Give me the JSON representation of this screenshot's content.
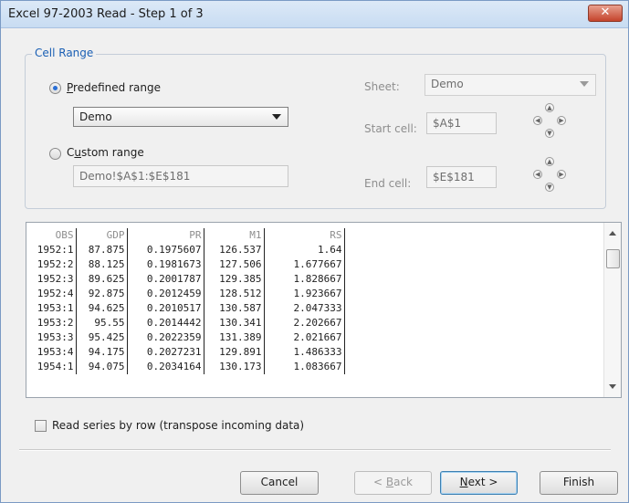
{
  "window": {
    "title": "Excel 97-2003 Read - Step 1 of 3",
    "close_symbol": "✕"
  },
  "cell_range": {
    "group_label": "Cell Range",
    "predefined_label_u": "P",
    "predefined_label_rest": "redefined range",
    "predefined_selected": true,
    "predefined_value": "Demo",
    "custom_label_pre": "C",
    "custom_label_u": "u",
    "custom_label_rest": "stom range",
    "custom_value": "Demo!$A$1:$E$181",
    "sheet_label": "Sheet:",
    "sheet_value": "Demo",
    "start_label": "Start cell:",
    "start_value": "$A$1",
    "end_label": "End cell:",
    "end_value": "$E$181"
  },
  "preview": {
    "headers": [
      "OBS",
      "GDP",
      "PR",
      "M1",
      "RS"
    ],
    "rows": [
      [
        "1952:1",
        "87.875",
        "0.1975607",
        "126.537",
        "1.64"
      ],
      [
        "1952:2",
        "88.125",
        "0.1981673",
        "127.506",
        "1.677667"
      ],
      [
        "1952:3",
        "89.625",
        "0.2001787",
        "129.385",
        "1.828667"
      ],
      [
        "1952:4",
        "92.875",
        "0.2012459",
        "128.512",
        "1.923667"
      ],
      [
        "1953:1",
        "94.625",
        "0.2010517",
        "130.587",
        "2.047333"
      ],
      [
        "1953:2",
        "95.55",
        "0.2014442",
        "130.341",
        "2.202667"
      ],
      [
        "1953:3",
        "95.425",
        "0.2022359",
        "131.389",
        "2.021667"
      ],
      [
        "1953:4",
        "94.175",
        "0.2027231",
        "129.891",
        "1.486333"
      ],
      [
        "1954:1",
        "94.075",
        "0.2034164",
        "130.173",
        "1.083667"
      ]
    ]
  },
  "options": {
    "transpose_label": "Read series by row (transpose incoming data)",
    "transpose_checked": false
  },
  "buttons": {
    "cancel": "Cancel",
    "back_pre": "< ",
    "back_u": "B",
    "back_rest": "ack",
    "next_u": "N",
    "next_rest": "ext >",
    "finish": "Finish"
  }
}
